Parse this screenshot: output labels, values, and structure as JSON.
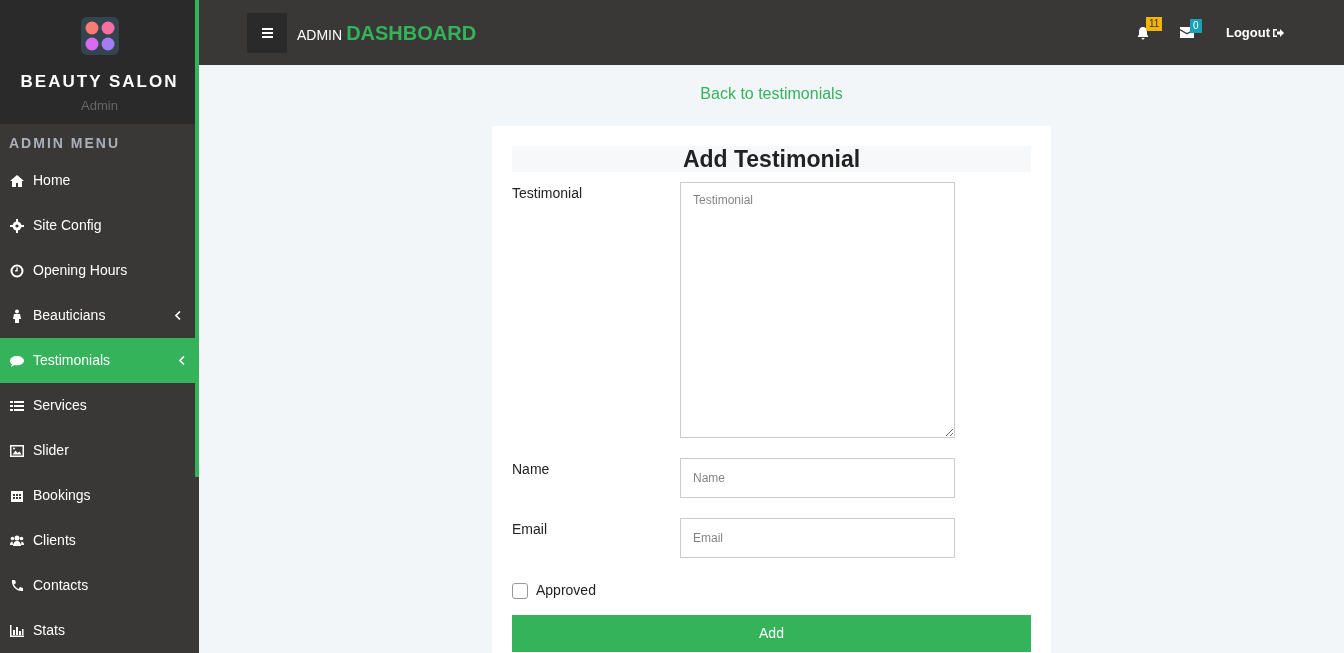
{
  "sidebar": {
    "brand": "BEAUTY SALON",
    "role": "Admin",
    "menu_title": "ADMIN MENU",
    "items": [
      {
        "label": "Home",
        "selected": false,
        "submenu": false
      },
      {
        "label": "Site Config",
        "selected": false,
        "submenu": false
      },
      {
        "label": "Opening Hours",
        "selected": false,
        "submenu": false
      },
      {
        "label": "Beauticians",
        "selected": false,
        "submenu": true
      },
      {
        "label": "Testimonials",
        "selected": true,
        "submenu": true
      },
      {
        "label": "Services",
        "selected": false,
        "submenu": false
      },
      {
        "label": "Slider",
        "selected": false,
        "submenu": false
      },
      {
        "label": "Bookings",
        "selected": false,
        "submenu": false
      },
      {
        "label": "Clients",
        "selected": false,
        "submenu": false
      },
      {
        "label": "Contacts",
        "selected": false,
        "submenu": false
      },
      {
        "label": "Stats",
        "selected": false,
        "submenu": false
      }
    ]
  },
  "header": {
    "title_prefix": "ADMIN",
    "title": "DASHBOARD",
    "notifications": "11",
    "messages": "0",
    "logout": "Logout"
  },
  "back_link": "Back to testimonials",
  "form": {
    "title": "Add Testimonial",
    "fields": [
      {
        "kind": "textarea",
        "label": "Testimonial",
        "placeholder": "Testimonial"
      },
      {
        "kind": "input",
        "label": "Name",
        "placeholder": "Name"
      },
      {
        "kind": "input",
        "label": "Email",
        "placeholder": "Email"
      }
    ],
    "approved": {
      "label": "Approved",
      "checked": false
    },
    "submit": "Add"
  }
}
